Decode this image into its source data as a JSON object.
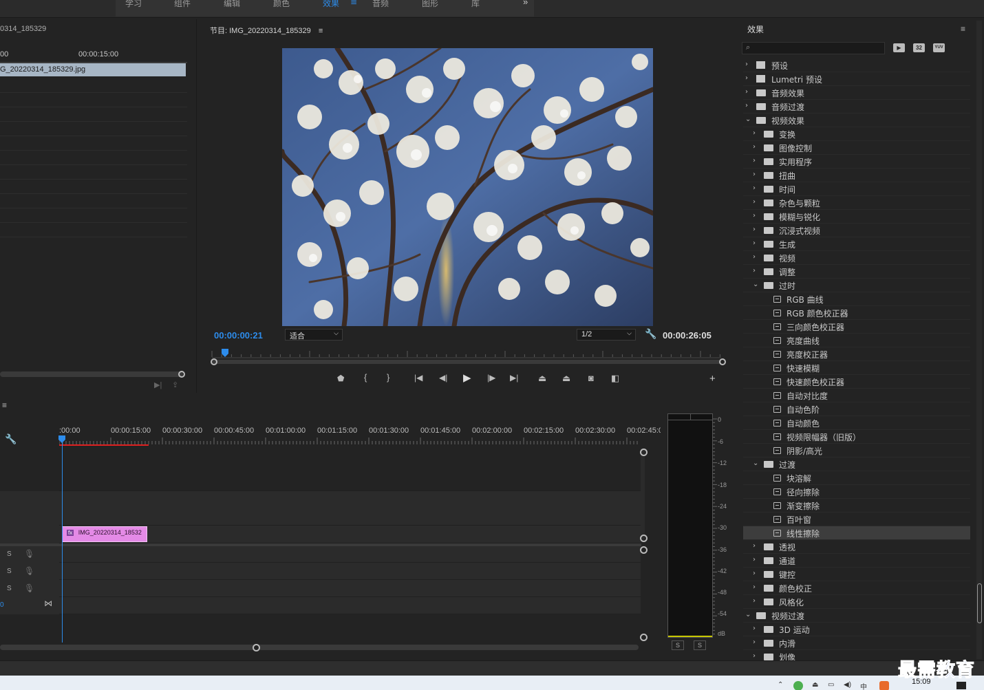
{
  "workspace": {
    "tabs": [
      "学习",
      "组件",
      "编辑",
      "颜色",
      "效果",
      "音频",
      "图形",
      "库"
    ],
    "active_tab": "效果",
    "more_label": "»"
  },
  "source": {
    "title": "0314_185329",
    "tc_left": "00",
    "tc_right": "00:00:15:00",
    "clip_name": "G_20220314_185329.jpg"
  },
  "program": {
    "title": "节目: IMG_20220314_185329",
    "menu_icon": "≡",
    "current_time": "00:00:00:21",
    "fit_label": "适合",
    "resolution_label": "1/2",
    "duration": "00:00:26:05"
  },
  "timeline": {
    "menu_icon": "≡",
    "ruler": [
      ":00:00",
      "00:00:15:00",
      "00:00:30:00",
      "00:00:45:00",
      "00:01:00:00",
      "00:01:15:00",
      "00:01:30:00",
      "00:01:45:00",
      "00:02:00:00",
      "00:02:15:00",
      "00:02:30:00",
      "00:02:45:0"
    ],
    "clip_label": "IMG_20220314_18532",
    "clip_fx": "fx",
    "audio_s": "S",
    "left_val": "0"
  },
  "meter": {
    "db_labels": [
      "0",
      "-6",
      "-12",
      "-18",
      "-24",
      "-30",
      "-36",
      "-42",
      "-48",
      "-54",
      "dB"
    ],
    "solo_left": "S",
    "solo_right": "S"
  },
  "effects": {
    "title": "效果",
    "menu_icon": "≡",
    "search_placeholder": "",
    "badge_32": "32",
    "badge_yuv": "YUV",
    "items": [
      {
        "label": "预设",
        "depth": 0,
        "kind": "preset",
        "open": false
      },
      {
        "label": "Lumetri 预设",
        "depth": 0,
        "kind": "preset",
        "open": false
      },
      {
        "label": "音频效果",
        "depth": 0,
        "kind": "folder",
        "open": false
      },
      {
        "label": "音频过渡",
        "depth": 0,
        "kind": "folder",
        "open": false
      },
      {
        "label": "视频效果",
        "depth": 0,
        "kind": "folder",
        "open": true
      },
      {
        "label": "变换",
        "depth": 1,
        "kind": "folder",
        "open": false
      },
      {
        "label": "图像控制",
        "depth": 1,
        "kind": "folder",
        "open": false
      },
      {
        "label": "实用程序",
        "depth": 1,
        "kind": "folder",
        "open": false
      },
      {
        "label": "扭曲",
        "depth": 1,
        "kind": "folder",
        "open": false
      },
      {
        "label": "时间",
        "depth": 1,
        "kind": "folder",
        "open": false
      },
      {
        "label": "杂色与颗粒",
        "depth": 1,
        "kind": "folder",
        "open": false
      },
      {
        "label": "模糊与锐化",
        "depth": 1,
        "kind": "folder",
        "open": false
      },
      {
        "label": "沉浸式视频",
        "depth": 1,
        "kind": "folder",
        "open": false
      },
      {
        "label": "生成",
        "depth": 1,
        "kind": "folder",
        "open": false
      },
      {
        "label": "视频",
        "depth": 1,
        "kind": "folder",
        "open": false
      },
      {
        "label": "调整",
        "depth": 1,
        "kind": "folder",
        "open": false
      },
      {
        "label": "过时",
        "depth": 1,
        "kind": "folder",
        "open": true
      },
      {
        "label": "RGB 曲线",
        "depth": 2,
        "kind": "effect"
      },
      {
        "label": "RGB 颜色校正器",
        "depth": 2,
        "kind": "effect"
      },
      {
        "label": "三向颜色校正器",
        "depth": 2,
        "kind": "effect"
      },
      {
        "label": "亮度曲线",
        "depth": 2,
        "kind": "effect"
      },
      {
        "label": "亮度校正器",
        "depth": 2,
        "kind": "effect"
      },
      {
        "label": "快速模糊",
        "depth": 2,
        "kind": "effect"
      },
      {
        "label": "快速颜色校正器",
        "depth": 2,
        "kind": "effect"
      },
      {
        "label": "自动对比度",
        "depth": 2,
        "kind": "effect"
      },
      {
        "label": "自动色阶",
        "depth": 2,
        "kind": "effect"
      },
      {
        "label": "自动颜色",
        "depth": 2,
        "kind": "effect"
      },
      {
        "label": "视频限幅器（旧版）",
        "depth": 2,
        "kind": "effect"
      },
      {
        "label": "阴影/高光",
        "depth": 2,
        "kind": "effect"
      },
      {
        "label": "过渡",
        "depth": 1,
        "kind": "folder",
        "open": true
      },
      {
        "label": "块溶解",
        "depth": 2,
        "kind": "effect"
      },
      {
        "label": "径向擦除",
        "depth": 2,
        "kind": "effect"
      },
      {
        "label": "渐变擦除",
        "depth": 2,
        "kind": "effect"
      },
      {
        "label": "百叶窗",
        "depth": 2,
        "kind": "effect"
      },
      {
        "label": "线性擦除",
        "depth": 2,
        "kind": "effect",
        "selected": true
      },
      {
        "label": "透视",
        "depth": 1,
        "kind": "folder",
        "open": false
      },
      {
        "label": "通道",
        "depth": 1,
        "kind": "folder",
        "open": false
      },
      {
        "label": "键控",
        "depth": 1,
        "kind": "folder",
        "open": false
      },
      {
        "label": "颜色校正",
        "depth": 1,
        "kind": "folder",
        "open": false
      },
      {
        "label": "风格化",
        "depth": 1,
        "kind": "folder",
        "open": false
      },
      {
        "label": "视频过渡",
        "depth": 0,
        "kind": "folder",
        "open": true
      },
      {
        "label": "3D 运动",
        "depth": 1,
        "kind": "folder",
        "open": false
      },
      {
        "label": "内滑",
        "depth": 1,
        "kind": "folder",
        "open": false
      },
      {
        "label": "划像",
        "depth": 1,
        "kind": "folder",
        "open": false
      }
    ]
  },
  "watermark": "最需教育",
  "clock": "15:09",
  "colors": {
    "accent": "#2d8ceb",
    "clip_pink": "#e48ae6",
    "source_clip": "#a7b6c5",
    "in_out_red": "#e02020"
  }
}
